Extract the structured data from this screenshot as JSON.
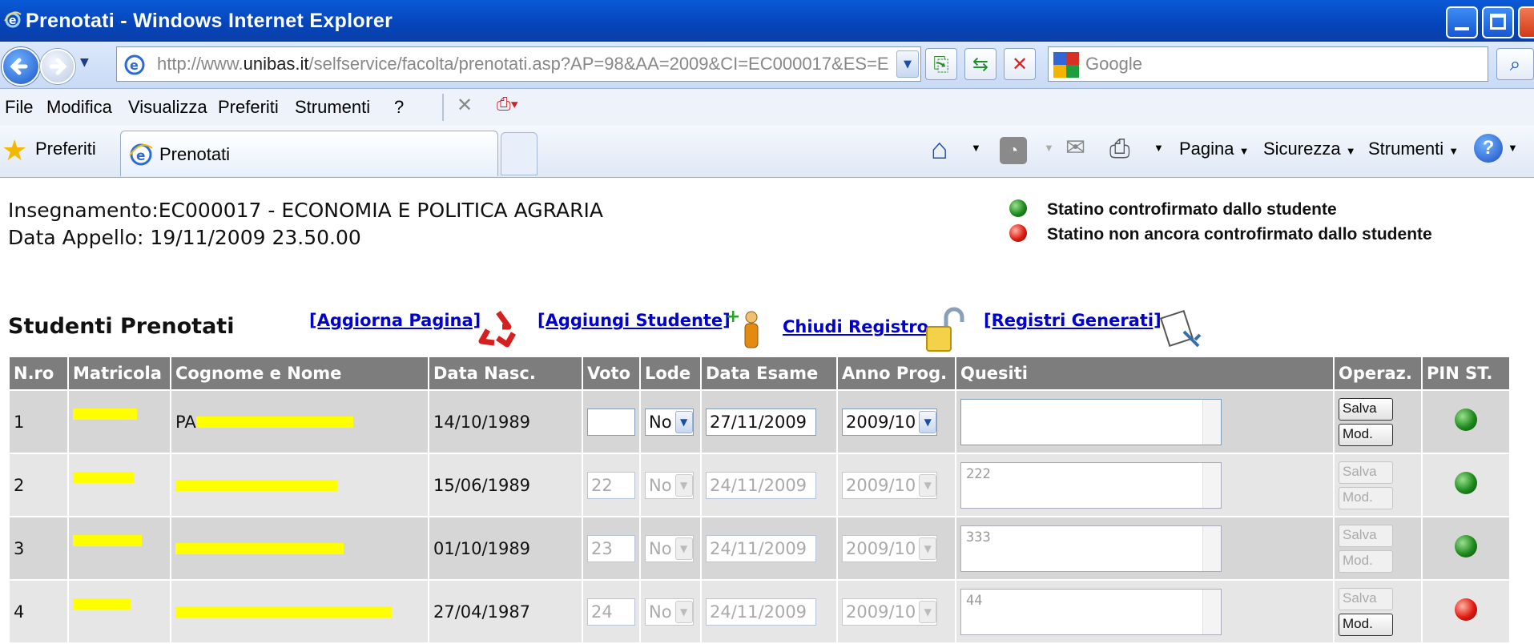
{
  "window": {
    "title": "Prenotati - Windows Internet Explorer"
  },
  "address": {
    "prefix": "http://www.",
    "domain": "unibas.it",
    "path": "/selfservice/facolta/prenotati.asp?AP=98&AA=2009&CI=EC000017&ES=E"
  },
  "search": {
    "placeholder": "Google"
  },
  "menu": {
    "items": [
      "File",
      "Modifica",
      "Visualizza",
      "Preferiti",
      "Strumenti",
      "?"
    ]
  },
  "favbar": {
    "favorites_label": "Preferiti",
    "tab_label": "Prenotati",
    "pagina": "Pagina",
    "sicurezza": "Sicurezza",
    "strumenti": "Strumenti"
  },
  "page": {
    "insegnamento": "Insegnamento:EC000017 - ECONOMIA E POLITICA AGRARIA",
    "data_appello": "Data Appello: 19/11/2009 23.50.00",
    "legend_green": "Statino controfirmato dallo studente",
    "legend_red": "Statino non ancora controfirmato dallo studente",
    "section_title": "Studenti Prenotati",
    "link_refresh": "[Aggiorna Pagina]",
    "link_add": "[Aggiungi Studente]",
    "link_close": "Chiudi Registro",
    "link_registers": "[Registri Generati]"
  },
  "table": {
    "headers": [
      "N.ro",
      "Matricola",
      "Cognome e Nome",
      "Data Nasc.",
      "Voto",
      "Lode",
      "Data Esame",
      "Anno Prog.",
      "Quesiti",
      "Operaz.",
      "PIN ST."
    ],
    "buttons": {
      "save": "Salva",
      "edit": "Mod."
    },
    "rows": [
      {
        "n": "1",
        "nome": "PA",
        "nascita": "14/10/1989",
        "voto": "",
        "lode": "No",
        "data_esame": "27/11/2009",
        "anno": "2009/10",
        "quesiti": "",
        "enabled": true,
        "edit_enabled": true,
        "pin": "green"
      },
      {
        "n": "2",
        "nome": "",
        "nascita": "15/06/1989",
        "voto": "22",
        "lode": "No",
        "data_esame": "24/11/2009",
        "anno": "2009/10",
        "quesiti": "222",
        "enabled": false,
        "edit_enabled": false,
        "pin": "green"
      },
      {
        "n": "3",
        "nome": "",
        "nascita": "01/10/1989",
        "voto": "23",
        "lode": "No",
        "data_esame": "24/11/2009",
        "anno": "2009/10",
        "quesiti": "333",
        "enabled": false,
        "edit_enabled": false,
        "pin": "green"
      },
      {
        "n": "4",
        "nome": "",
        "nascita": "27/04/1987",
        "voto": "24",
        "lode": "No",
        "data_esame": "24/11/2009",
        "anno": "2009/10",
        "quesiti": "44",
        "enabled": false,
        "edit_enabled": true,
        "pin": "red"
      }
    ]
  }
}
